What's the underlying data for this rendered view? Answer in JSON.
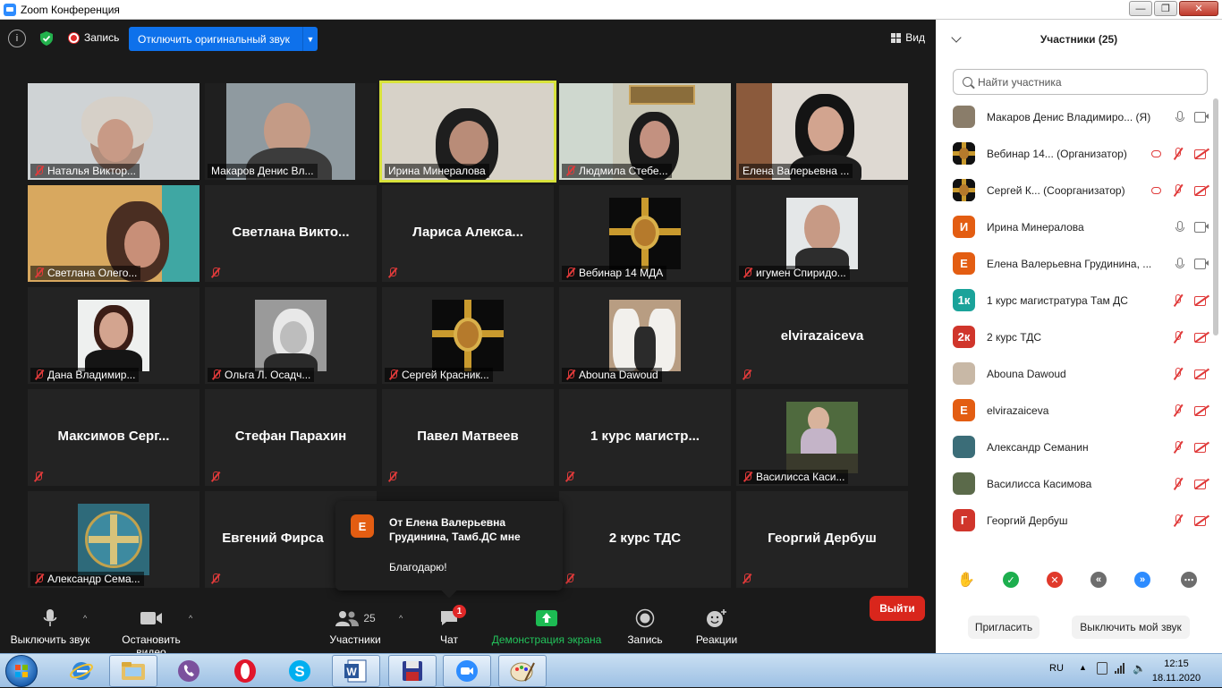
{
  "window": {
    "title": "Zoom Конференция"
  },
  "topbar": {
    "record_label": "Запись",
    "disable_sound": "Отключить оригинальный звук",
    "view_label": "Вид"
  },
  "tiles": [
    {
      "label": "Наталья Виктор..."
    },
    {
      "label": "Макаров Денис Вл..."
    },
    {
      "label": "Ирина Минералова"
    },
    {
      "label": "Людмила Стебе..."
    },
    {
      "label": "Елена Валерьевна ..."
    },
    {
      "label": "Светлана Олего..."
    },
    {
      "center": "Светлана  Викто..."
    },
    {
      "center": "Лариса  Алекса..."
    },
    {
      "label": "Вебинар 14 МДА"
    },
    {
      "label": "игумен Спиридо..."
    },
    {
      "label": "Дана Владимир..."
    },
    {
      "label": "Ольга Л. Осадч..."
    },
    {
      "label": "Сергей Красник..."
    },
    {
      "label": "Abouna Dawoud"
    },
    {
      "center": "elvirazaiceva"
    },
    {
      "center": "Максимов  Серг..."
    },
    {
      "center": "Стефан Парахин"
    },
    {
      "center": "Павел Матвеев"
    },
    {
      "center": "1  курс  магистр..."
    },
    {
      "label": "Василисса Каси..."
    },
    {
      "label": "Александр Сема..."
    },
    {
      "center": "Евгений Фирса"
    },
    {
      "center": "2 курс ТДС"
    },
    {
      "center": "Георгий Дербуш"
    }
  ],
  "toast": {
    "avatar_letter": "Е",
    "from": "От Елена Валерьевна Грудинина, Тамб.ДС мне",
    "message": "Благодарю!"
  },
  "toolbar": {
    "mute": "Выключить звук",
    "stop_video": "Остановить видео",
    "participants": "Участники",
    "participants_count": "25",
    "chat": "Чат",
    "chat_badge": "1",
    "share": "Демонстрация экрана",
    "record": "Запись",
    "reactions": "Реакции",
    "leave": "Выйти"
  },
  "panel": {
    "title": "Участники (25)",
    "search_placeholder": "Найти участника",
    "invite": "Пригласить",
    "mute_me": "Выключить мой звук",
    "participants": [
      {
        "name": "Макаров Денис Владимиро... (Я)",
        "avatar": "",
        "color": "#8a7d6a",
        "mic": "on",
        "cam": "on"
      },
      {
        "name": "Вебинар 14...  (Организатор)",
        "avatar": "",
        "color": "#111111",
        "mic": "off",
        "cam": "off"
      },
      {
        "name": "Сергей К...  (Соорганизатор)",
        "avatar": "",
        "color": "#111111",
        "mic": "off",
        "cam": "off"
      },
      {
        "name": "Ирина Минералова",
        "avatar": "И",
        "color": "#e35d12",
        "mic": "on",
        "cam": "on"
      },
      {
        "name": "Елена Валерьевна Грудинина, ...",
        "avatar": "Е",
        "color": "#e35d12",
        "mic": "on",
        "cam": "on"
      },
      {
        "name": "1 курс магистратура Там ДС",
        "avatar": "1к",
        "color": "#1aa39a",
        "mic": "off",
        "cam": "off"
      },
      {
        "name": "2 курс ТДС",
        "avatar": "2к",
        "color": "#d0352b",
        "mic": "off",
        "cam": "off"
      },
      {
        "name": "Abouna Dawoud",
        "avatar": "",
        "color": "#c8b8a6",
        "mic": "off",
        "cam": "off"
      },
      {
        "name": "elvirazaiceva",
        "avatar": "Е",
        "color": "#e35d12",
        "mic": "off",
        "cam": "off"
      },
      {
        "name": "Александр Семанин",
        "avatar": "",
        "color": "#3b6d78",
        "mic": "off",
        "cam": "off"
      },
      {
        "name": "Василисса Касимова",
        "avatar": "",
        "color": "#5b6a4a",
        "mic": "off",
        "cam": "off"
      },
      {
        "name": "Георгий Дербуш",
        "avatar": "Г",
        "color": "#d0352b",
        "mic": "off",
        "cam": "off"
      }
    ]
  },
  "taskbar": {
    "lang": "RU",
    "time": "12:15",
    "date": "18.11.2020"
  }
}
